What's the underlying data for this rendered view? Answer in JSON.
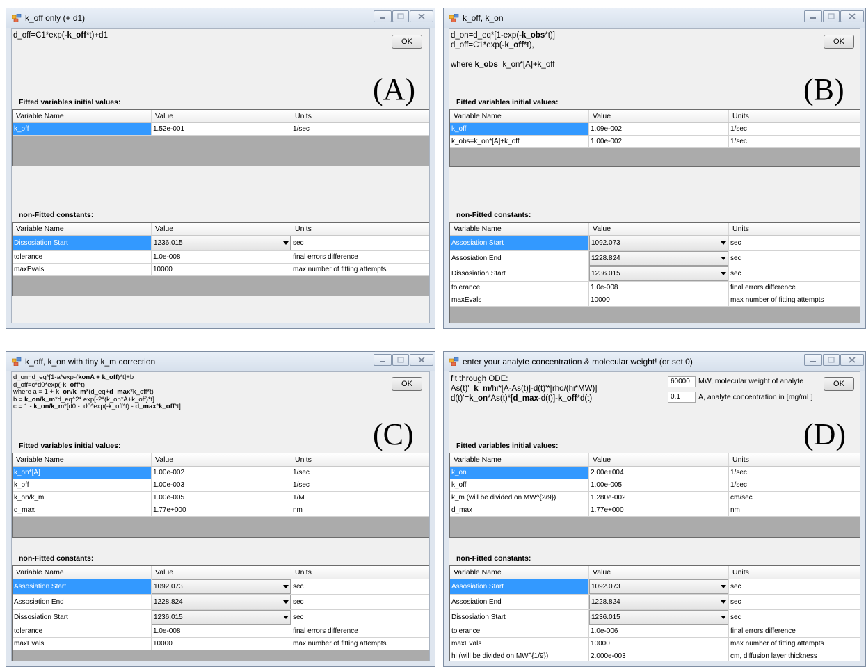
{
  "windows": {
    "A": {
      "title": "k_off only (+ d1)",
      "equation": "d_off=C1*exp(-<b>k_off</b>*t)+d1",
      "ok": "OK",
      "tag": "(A)",
      "fitted_label": "Fitted variables initial values:",
      "constants_label": "non-Fitted constants:",
      "fitted_header": [
        "Variable Name",
        "Value",
        "Units"
      ],
      "fitted_rows": [
        {
          "name": "k_off",
          "value": "1.52e-001",
          "units": "1/sec",
          "selected": true
        }
      ],
      "constants_header": [
        "Variable Name",
        "Value",
        "Units"
      ],
      "constants_rows": [
        {
          "name": "Dissosiation Start",
          "value": "1236.015",
          "units": "sec",
          "selected": true,
          "combo": true
        },
        {
          "name": "tolerance",
          "value": "1.0e-008",
          "units": "final errors difference"
        },
        {
          "name": "maxEvals",
          "value": "10000",
          "units": "max number of fitting attempts"
        }
      ]
    },
    "B": {
      "title": "k_off, k_on",
      "equation": "d_on=d_eq*[1-exp(-<b>k_obs</b>*t)]\nd_off=C1*exp(-<b>k_off</b>*t),\n\nwhere <b>k_obs</b>=k_on*[A]+k_off",
      "ok": "OK",
      "tag": "(B)",
      "fitted_label": "Fitted variables initial values:",
      "constants_label": "non-Fitted constants:",
      "fitted_header": [
        "Variable Name",
        "Value",
        "Units"
      ],
      "fitted_rows": [
        {
          "name": "k_off",
          "value": "1.09e-002",
          "units": "1/sec",
          "selected": true
        },
        {
          "name": "k_obs=k_on*[A]+k_off",
          "value": "1.00e-002",
          "units": "1/sec"
        }
      ],
      "constants_header": [
        "Variable Name",
        "Value",
        "Units"
      ],
      "constants_rows": [
        {
          "name": "Assosiation Start",
          "value": "1092.073",
          "units": "sec",
          "selected": true,
          "combo": true
        },
        {
          "name": "Assosiation End",
          "value": "1228.824",
          "units": "sec",
          "combo": true
        },
        {
          "name": "Dissosiation Start",
          "value": "1236.015",
          "units": "sec",
          "combo": true
        },
        {
          "name": "tolerance",
          "value": "1.0e-008",
          "units": "final errors difference"
        },
        {
          "name": "maxEvals",
          "value": "10000",
          "units": "max number of fitting attempts"
        }
      ]
    },
    "C": {
      "title": "k_off, k_on with tiny k_m correction",
      "equation": "d_on=d_eq*[1-a*exp-(<b>konA + k_off</b>)*t]+b\nd_off=c*d0*exp(-<b>k_off</b>*t),\nwhere a = 1 + <b>k_on/k_m</b>*(d_eq+<b>d_max</b>*k_off*t)\nb = <b>k_on/k_m</b>*d_eq^2* exp[-2*(k_on*A+k_off)*t]\nc = 1 - <b>k_on/k_m</b>*[d0 -  d0*exp(-k_off*t) - <b>d_max</b>*<b>k_off</b>*t]",
      "ok": "OK",
      "tag": "(C)",
      "fitted_label": "Fitted variables initial values:",
      "constants_label": "non-Fitted constants:",
      "fitted_header": [
        "Variable Name",
        "Value",
        "Units"
      ],
      "fitted_rows": [
        {
          "name": "k_on*[A]",
          "value": "1.00e-002",
          "units": "1/sec",
          "selected": true
        },
        {
          "name": "k_off",
          "value": "1.00e-003",
          "units": "1/sec"
        },
        {
          "name": "k_on/k_m",
          "value": "1.00e-005",
          "units": "1/M"
        },
        {
          "name": "d_max",
          "value": "1.77e+000",
          "units": "nm"
        }
      ],
      "constants_header": [
        "Variable Name",
        "Value",
        "Units"
      ],
      "constants_rows": [
        {
          "name": "Assosiation Start",
          "value": "1092.073",
          "units": "sec",
          "selected": true,
          "combo": true
        },
        {
          "name": "Assosiation End",
          "value": "1228.824",
          "units": "sec",
          "combo": true
        },
        {
          "name": "Dissosiation Start",
          "value": "1236.015",
          "units": "sec",
          "combo": true
        },
        {
          "name": "tolerance",
          "value": "1.0e-008",
          "units": "final errors difference"
        },
        {
          "name": "maxEvals",
          "value": "10000",
          "units": "max number of fitting attempts"
        }
      ]
    },
    "D": {
      "title": "enter your analyte concentration & molecular weight! (or set 0)",
      "equation": "fit through ODE:\nAs(t)'=<b>k_m</b>/hi*[A-As(t)]-d(t)'*[rho/(hi*MW)]\nd(t)'=<b>k_on</b>*As(t)*[<b>d_max</b>-d(t)]-<b>k_off</b>*d(t)",
      "ok": "OK",
      "tag": "(D)",
      "mw_value": "60000",
      "mw_label": "MW, molecular weight of analyte",
      "a_value": "0.1",
      "a_label": "A, analyte concentration in [mg/mL]",
      "fitted_label": "Fitted variables initial values:",
      "constants_label": "non-Fitted constants:",
      "fitted_header": [
        "Variable Name",
        "Value",
        "Units"
      ],
      "fitted_rows": [
        {
          "name": "k_on",
          "value": "2.00e+004",
          "units": "1/sec",
          "selected": true
        },
        {
          "name": "k_off",
          "value": "1.00e-005",
          "units": "1/sec"
        },
        {
          "name": "k_m (will be divided on MW^{2/9})",
          "value": "1.280e-002",
          "units": "cm/sec"
        },
        {
          "name": "d_max",
          "value": "1.77e+000",
          "units": "nm"
        }
      ],
      "constants_header": [
        "Variable Name",
        "Value",
        "Units"
      ],
      "constants_rows": [
        {
          "name": "Assosiation Start",
          "value": "1092.073",
          "units": "sec",
          "selected": true,
          "combo": true
        },
        {
          "name": "Assosiation End",
          "value": "1228.824",
          "units": "sec",
          "combo": true
        },
        {
          "name": "Dissosiation Start",
          "value": "1236.015",
          "units": "sec",
          "combo": true
        },
        {
          "name": "tolerance",
          "value": "1.0e-006",
          "units": "final errors difference"
        },
        {
          "name": "maxEvals",
          "value": "10000",
          "units": "max number of fitting attempts"
        },
        {
          "name": "hi (will be divided on MW^{1/9})",
          "value": "2.000e-003",
          "units": "cm, diffusion layer thickness"
        }
      ]
    }
  },
  "colors": {
    "selection": "#3399ff",
    "grid_empty": "#ababab"
  },
  "icons": {
    "app": "app-icon",
    "minimize": "minimize-icon",
    "maximize": "maximize-icon",
    "close": "close-icon"
  }
}
